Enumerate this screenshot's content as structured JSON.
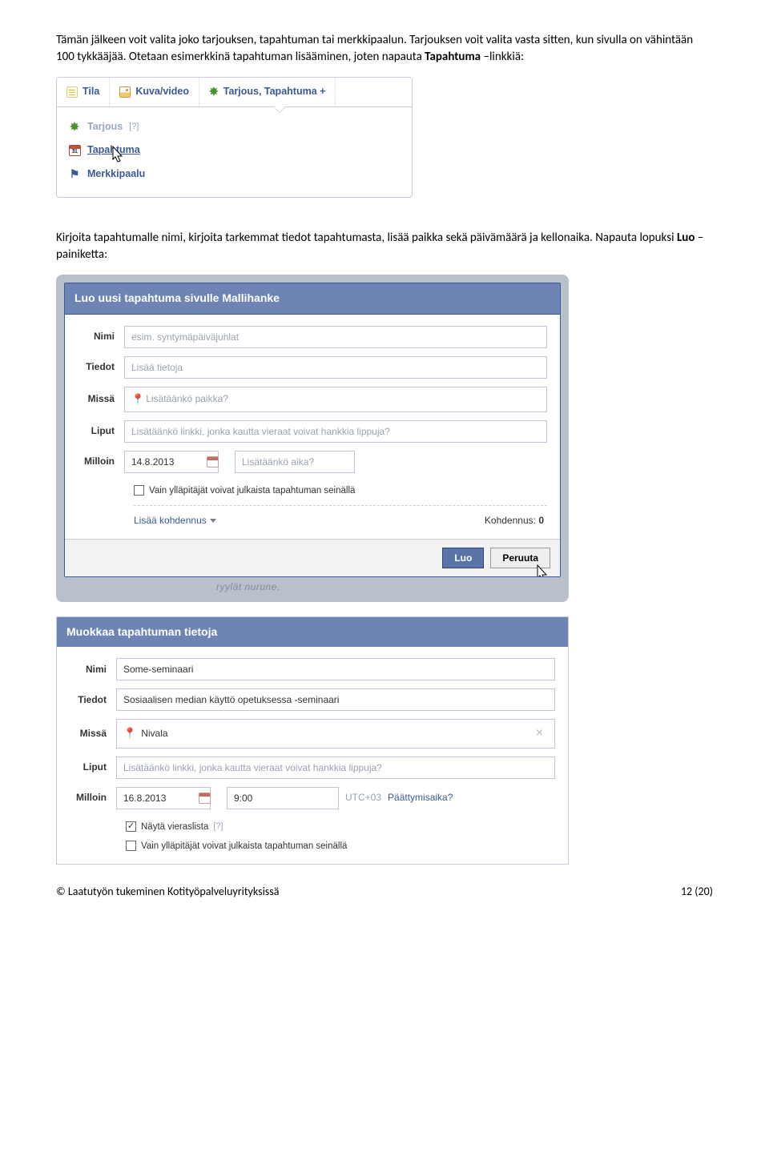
{
  "intro": {
    "p1a": "Tämän jälkeen voit valita joko tarjouksen, tapahtuman tai merkkipaalun. Tarjouksen voit valita vasta sitten, kun sivulla on vähintään 100 tykkääjää. Otetaan esimerkkinä tapahtuman lisääminen, joten napauta ",
    "p1b": "Tapahtuma",
    "p1c": " –linkkiä:",
    "p2a": "Kirjoita tapahtumalle nimi, kirjoita tarkemmat tiedot tapahtumasta, lisää paikka sekä päivämäärä ja kellonaika. Napauta lopuksi ",
    "p2b": "Luo",
    "p2c": " –painiketta:"
  },
  "fig1": {
    "tab_tila": "Tila",
    "tab_kuva": "Kuva/video",
    "tab_tarjous": "Tarjous, Tapahtuma +",
    "opt_tarjous": "Tarjous",
    "opt_qmark": "[?]",
    "opt_tapahtuma": "Tapahtuma",
    "opt_merkkipaalu": "Merkkipaalu"
  },
  "create": {
    "title": "Luo uusi tapahtuma sivulle Mallihanke",
    "labels": {
      "nimi": "Nimi",
      "tiedot": "Tiedot",
      "missa": "Missä",
      "liput": "Liput",
      "milloin": "Milloin"
    },
    "placeholders": {
      "nimi": "esim. syntymäpäiväjuhlat",
      "tiedot": "Lisää tietoja",
      "missa": "Lisätäänkö paikka?",
      "liput": "Lisätäänkö linkki, jonka kautta vieraat voivat hankkia lippuja?",
      "aika": "Lisätäänkö aika?"
    },
    "date": "14.8.2013",
    "chk_admins": "Vain ylläpitäjät voivat julkaista tapahtuman seinällä",
    "kohdennus_link": "Lisää kohdennus",
    "kohdennus_label": "Kohdennus:",
    "kohdennus_val": "0",
    "btn_luo": "Luo",
    "btn_peruuta": "Peruuta",
    "under_text": "ryylät nurune."
  },
  "edit": {
    "title": "Muokkaa tapahtuman tietoja",
    "labels": {
      "nimi": "Nimi",
      "tiedot": "Tiedot",
      "missa": "Missä",
      "liput": "Liput",
      "milloin": "Milloin"
    },
    "nimi": "Some-seminaari",
    "tiedot": "Sosiaalisen median käyttö opetuksessa -seminaari",
    "missa": "Nivala",
    "liput_placeholder": "Lisätäänkö linkki, jonka kautta vieraat voivat hankkia lippuja?",
    "date": "16.8.2013",
    "time": "9:00",
    "tz": "UTC+03",
    "endtime": "Päättymisaika?",
    "chk_guestlist": "Näytä vieraslista",
    "qmark": "[?]",
    "chk_admins": "Vain ylläpitäjät voivat julkaista tapahtuman seinällä"
  },
  "footer": {
    "left": "© Laatutyön tukeminen Kotityöpalveluyrityksissä",
    "right": "12 (20)"
  }
}
